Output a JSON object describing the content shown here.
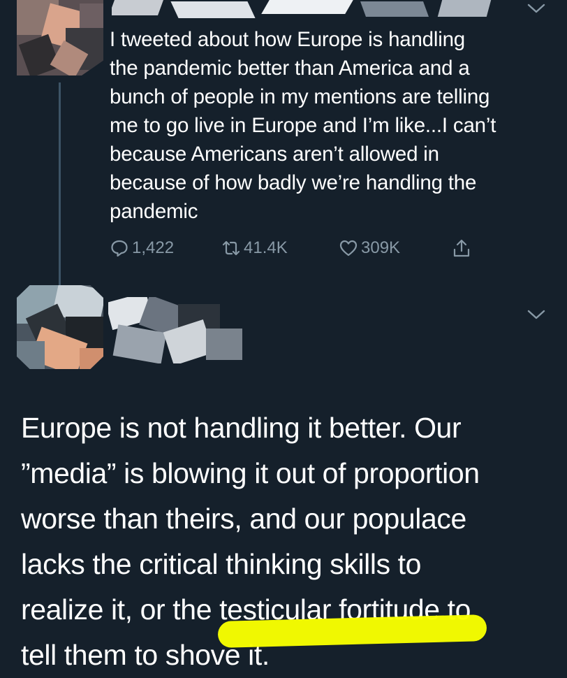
{
  "colors": {
    "background": "#15202b",
    "text": "#ffffff",
    "muted": "#8899a6",
    "thread_line": "#3d5466",
    "highlighter": "#f8ff00"
  },
  "tweet1": {
    "text_lines": [
      "I tweeted about how Europe is handling",
      "the pandemic better than America and a",
      "bunch of people in my mentions are telling",
      "me to go live in Europe and I’m like...I can’t",
      "because Americans aren’t allowed in",
      "because of how badly we’re handling the",
      "pandemic"
    ],
    "replies": "1,422",
    "retweets": "41.4K",
    "likes": "309K",
    "icons": [
      "reply-icon",
      "retweet-icon",
      "like-icon",
      "share-icon",
      "chevron-down-icon"
    ]
  },
  "tweet2": {
    "text_lines": [
      "Europe is not handling it better. Our",
      "”media” is blowing it out of proportion",
      "worse than theirs, and our populace",
      "lacks the critical thinking skills to",
      "realize it, or the testicular fortitude to",
      "tell them to shove it."
    ],
    "icons": [
      "chevron-down-icon"
    ],
    "highlighted_phrase": "testicular fortitude"
  }
}
